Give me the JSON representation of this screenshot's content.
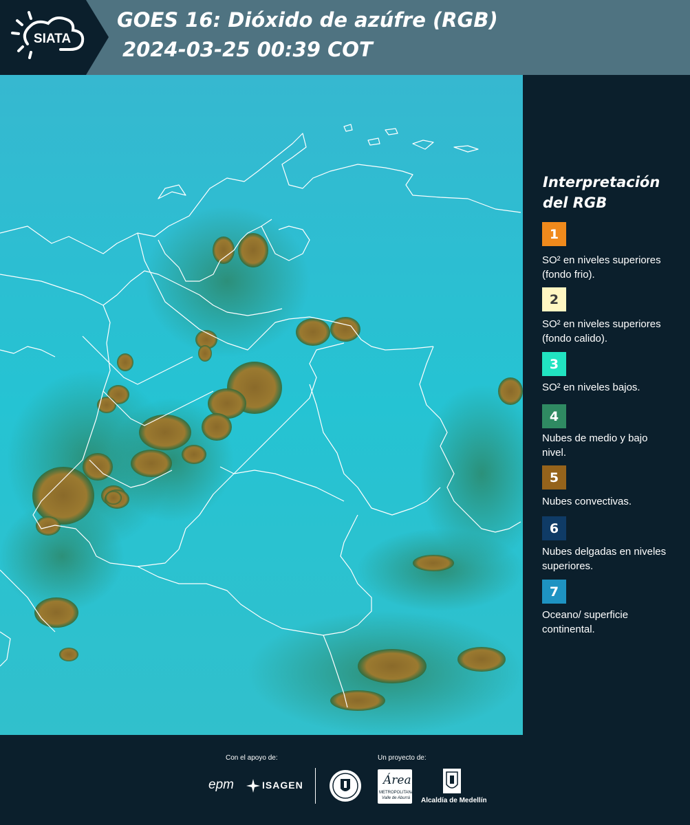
{
  "header": {
    "brand": "SIATA",
    "title": "GOES 16: Dióxido de azúfre (RGB)",
    "datetime": "2024-03-25 00:39 COT"
  },
  "legend": {
    "title_line1": "Interpretación",
    "title_line2": "del RGB",
    "items": [
      {
        "num": "1",
        "color": "#f08a1c",
        "text_color": "#ffffff",
        "label": "SO² en niveles superiores (fondo frio)."
      },
      {
        "num": "2",
        "color": "#fff6c2",
        "text_color": "#3a3a3a",
        "label": "SO² en niveles superiores (fondo calido)."
      },
      {
        "num": "3",
        "color": "#21e3c1",
        "text_color": "#ffffff",
        "label": "SO² en niveles bajos."
      },
      {
        "num": "4",
        "color": "#2f8a62",
        "text_color": "#ffffff",
        "label": "Nubes de medio y bajo nivel."
      },
      {
        "num": "5",
        "color": "#95631b",
        "text_color": "#ffffff",
        "label": "Nubes convectivas."
      },
      {
        "num": "6",
        "color": "#0f3b66",
        "text_color": "#ffffff",
        "label": "Nubes delgadas en niveles superiores."
      },
      {
        "num": "7",
        "color": "#1e93c2",
        "text_color": "#ffffff",
        "label": "Oceano/ superficie continental."
      }
    ]
  },
  "footer": {
    "support_caption": "Con el apoyo de:",
    "project_caption": "Un proyecto de:",
    "epm": "epm",
    "isagen": "ISAGEN",
    "area_logo": "Área",
    "area_sub1": "METROPOLITANA",
    "area_sub2": "Valle de Aburrá",
    "alcaldia": "Alcaldía de Medellín"
  },
  "colors": {
    "header_bg": "#4f7381",
    "panel_bg": "#0b1f2c",
    "map_background": "#29c0d2",
    "convective_cloud": "#a37a2c",
    "border_line": "#ffffff"
  }
}
